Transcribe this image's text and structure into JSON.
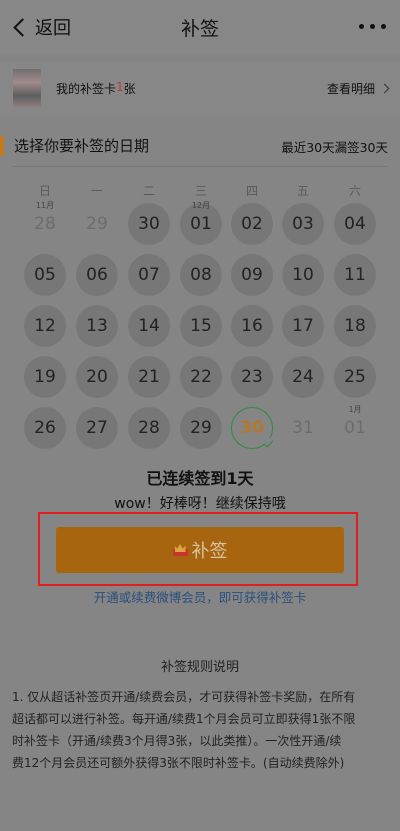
{
  "header": {
    "back_label": "返回",
    "title": "补签"
  },
  "card": {
    "label_prefix": "我的补签卡",
    "count": "1",
    "label_suffix": "张",
    "detail_label": "查看明细"
  },
  "calendar": {
    "section_title": "选择你要补签的日期",
    "range_note": "最近30天漏签30天",
    "weekdays": [
      "日",
      "一",
      "二",
      "三",
      "四",
      "五",
      "六"
    ],
    "weeks": [
      [
        {
          "d": "28",
          "m": "11月",
          "s": "muted"
        },
        {
          "d": "29",
          "s": "muted"
        },
        {
          "d": "30",
          "s": "filled"
        },
        {
          "d": "01",
          "m": "12月",
          "s": "filled"
        },
        {
          "d": "02",
          "s": "filled"
        },
        {
          "d": "03",
          "s": "filled"
        },
        {
          "d": "04",
          "s": "filled"
        }
      ],
      [
        {
          "d": "05",
          "s": "filled"
        },
        {
          "d": "06",
          "s": "filled"
        },
        {
          "d": "07",
          "s": "filled"
        },
        {
          "d": "08",
          "s": "filled"
        },
        {
          "d": "09",
          "s": "filled"
        },
        {
          "d": "10",
          "s": "filled"
        },
        {
          "d": "11",
          "s": "filled"
        }
      ],
      [
        {
          "d": "12",
          "s": "filled"
        },
        {
          "d": "13",
          "s": "filled"
        },
        {
          "d": "14",
          "s": "filled"
        },
        {
          "d": "15",
          "s": "filled"
        },
        {
          "d": "16",
          "s": "filled"
        },
        {
          "d": "17",
          "s": "filled"
        },
        {
          "d": "18",
          "s": "filled"
        }
      ],
      [
        {
          "d": "19",
          "s": "filled"
        },
        {
          "d": "20",
          "s": "filled"
        },
        {
          "d": "21",
          "s": "filled"
        },
        {
          "d": "22",
          "s": "filled"
        },
        {
          "d": "23",
          "s": "filled"
        },
        {
          "d": "24",
          "s": "filled"
        },
        {
          "d": "25",
          "s": "filled"
        }
      ],
      [
        {
          "d": "26",
          "s": "filled"
        },
        {
          "d": "27",
          "s": "filled"
        },
        {
          "d": "28",
          "s": "filled"
        },
        {
          "d": "29",
          "s": "filled"
        },
        {
          "d": "30",
          "s": "today"
        },
        {
          "d": "31",
          "s": "muted"
        },
        {
          "d": "01",
          "m": "1月",
          "s": "muted"
        }
      ]
    ]
  },
  "status": {
    "streak": "已连续签到1天",
    "cheer": "wow！好棒呀！继续保持哦"
  },
  "actions": {
    "makeup_label": "补签",
    "vip_link": "开通或续费微博会员，即可获得补签卡"
  },
  "rules": {
    "title": "补签规则说明",
    "lines": [
      "1. 仅从超话补签页开通/续费会员，才可获得补签卡奖励，在所有",
      "超话都可以进行补签。每开通/续费1个月会员可立即获得1张不限",
      "时补签卡（开通/续费3个月得3张，以此类推）。一次性开通/续",
      "费12个月会员还可额外获得3张不限时补签卡。(自动续费除外)"
    ]
  },
  "colors": {
    "accent": "#a8650f",
    "today_ring": "#2e8b3e",
    "highlight_box": "#e01e1e",
    "link": "#2b4f7c"
  }
}
